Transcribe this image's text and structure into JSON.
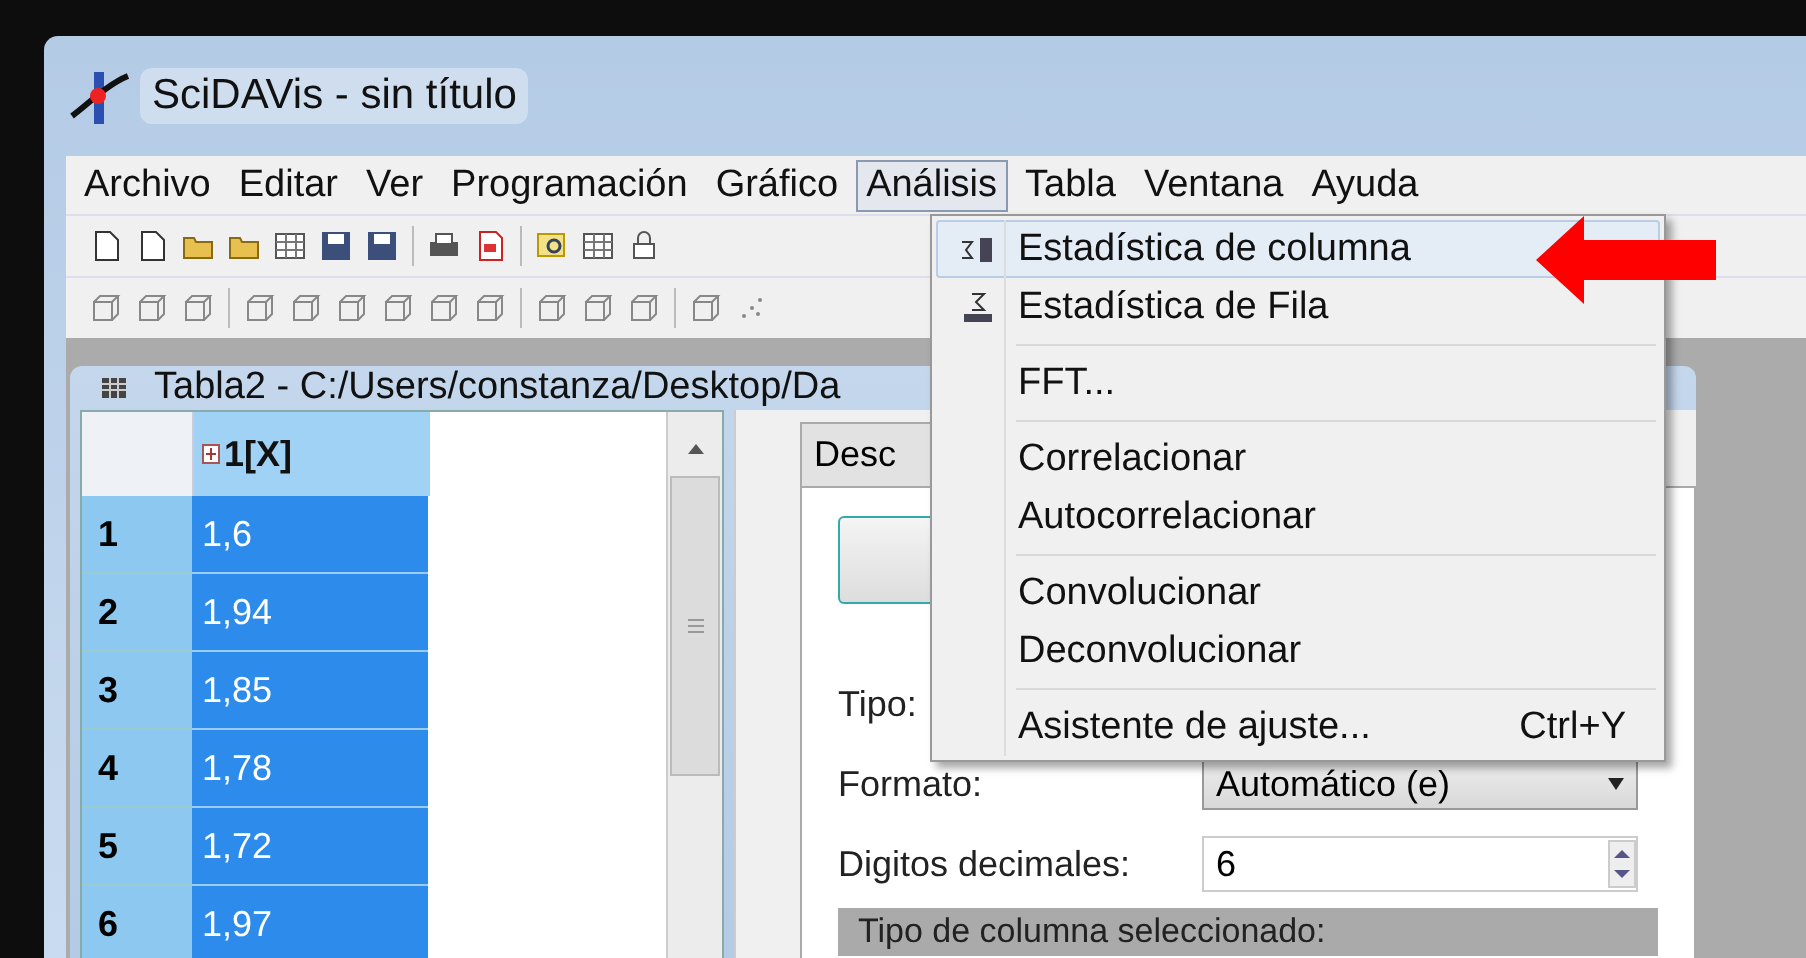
{
  "window": {
    "title": "SciDAVis - sin título"
  },
  "menubar": [
    {
      "label": "Archivo",
      "selected": false
    },
    {
      "label": "Editar",
      "selected": false
    },
    {
      "label": "Ver",
      "selected": false
    },
    {
      "label": "Programación",
      "selected": false
    },
    {
      "label": "Gráfico",
      "selected": false
    },
    {
      "label": "Análisis",
      "selected": true
    },
    {
      "label": "Tabla",
      "selected": false
    },
    {
      "label": "Ventana",
      "selected": false
    },
    {
      "label": "Ayuda",
      "selected": false
    }
  ],
  "menu": {
    "items": [
      {
        "kind": "column-stat",
        "label": "Estadística de columna",
        "selected": true
      },
      {
        "kind": "row-stat",
        "label": "Estadística de Fila",
        "selected": false
      },
      {
        "kind": "separator"
      },
      {
        "kind": "item",
        "label": "FFT...",
        "selected": false
      },
      {
        "kind": "separator"
      },
      {
        "kind": "item",
        "label": "Correlacionar",
        "selected": false
      },
      {
        "kind": "item",
        "label": "Autocorrelacionar",
        "selected": false
      },
      {
        "kind": "separator"
      },
      {
        "kind": "item",
        "label": "Convolucionar",
        "selected": false
      },
      {
        "kind": "item",
        "label": "Deconvolucionar",
        "selected": false
      },
      {
        "kind": "separator"
      },
      {
        "kind": "item",
        "label": "Asistente de ajuste...",
        "shortcut": "Ctrl+Y",
        "selected": false
      }
    ]
  },
  "subwindow": {
    "title": "Tabla2 - C:/Users/constanza/Desktop/Da"
  },
  "table": {
    "columns": [
      "1[X]"
    ],
    "rows": [
      {
        "number": "1",
        "value": "1,6",
        "selected": true
      },
      {
        "number": "2",
        "value": "1,94",
        "selected": true
      },
      {
        "number": "3",
        "value": "1,85",
        "selected": true
      },
      {
        "number": "4",
        "value": "1,78",
        "selected": true
      },
      {
        "number": "5",
        "value": "1,72",
        "selected": true
      },
      {
        "number": "6",
        "value": "1,97",
        "selected": true
      }
    ]
  },
  "panel": {
    "tabs": [
      "Desc"
    ],
    "fields": [
      {
        "kind": "label",
        "label": "Tipo:"
      },
      {
        "kind": "combo",
        "label": "Formato:",
        "value": "Automático (e)"
      },
      {
        "kind": "spin",
        "label": "Digitos decimales:",
        "value": "6"
      }
    ],
    "section": "Tipo de columna seleccionado:"
  }
}
